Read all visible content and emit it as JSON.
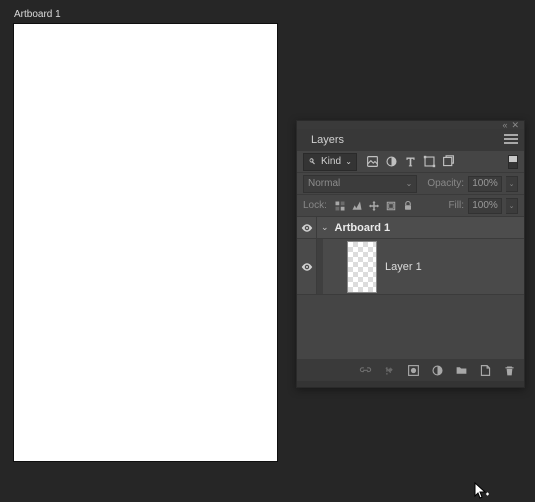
{
  "artboard": {
    "label": "Artboard 1"
  },
  "panel": {
    "title": "Layers",
    "kind_filter": {
      "label": "Kind"
    },
    "blend": {
      "mode": "Normal",
      "opacity_label": "Opacity:",
      "opacity_value": "100%",
      "fill_label": "Fill:",
      "fill_value": "100%"
    },
    "lock_label": "Lock:"
  },
  "tree": {
    "artboard": {
      "name": "Artboard 1"
    },
    "layers": [
      {
        "name": "Layer 1"
      }
    ]
  }
}
